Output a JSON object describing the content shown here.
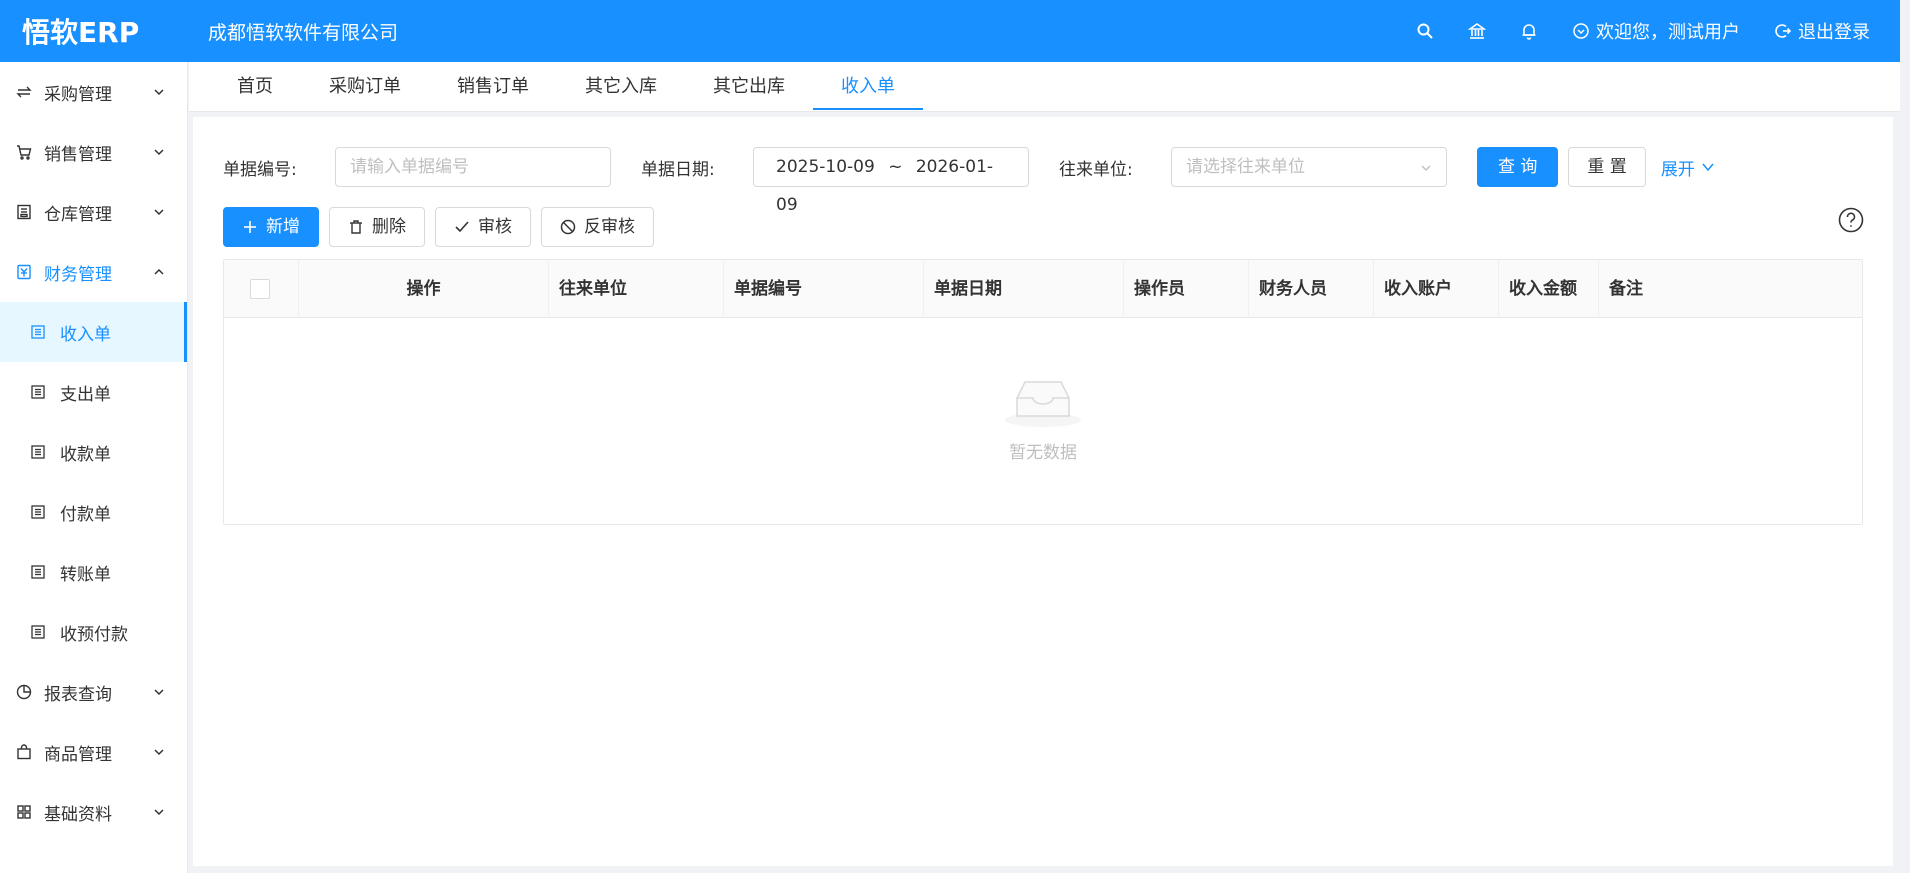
{
  "header": {
    "logo": "悟软ERP",
    "company": "成都悟软软件有限公司",
    "welcome": "欢迎您，测试用户",
    "logout": "退出登录"
  },
  "sidebar": {
    "items": [
      {
        "label": "采购管理",
        "icon": "swap-icon"
      },
      {
        "label": "销售管理",
        "icon": "cart-icon"
      },
      {
        "label": "仓库管理",
        "icon": "warehouse-icon"
      },
      {
        "label": "财务管理",
        "icon": "finance-icon"
      },
      {
        "label": "报表查询",
        "icon": "pie-icon"
      },
      {
        "label": "商品管理",
        "icon": "bag-icon"
      },
      {
        "label": "基础资料",
        "icon": "grid-icon"
      }
    ],
    "finance_sub": [
      {
        "label": "收入单"
      },
      {
        "label": "支出单"
      },
      {
        "label": "收款单"
      },
      {
        "label": "付款单"
      },
      {
        "label": "转账单"
      },
      {
        "label": "收预付款"
      }
    ]
  },
  "tabs": [
    "首页",
    "采购订单",
    "销售订单",
    "其它入库",
    "其它出库",
    "收入单"
  ],
  "filters": {
    "bill_no_label": "单据编号:",
    "bill_no_placeholder": "请输入单据编号",
    "date_label": "单据日期:",
    "date_start": "2025-10-09",
    "date_sep": "~",
    "date_end": "2026-01-09",
    "unit_label": "往来单位:",
    "unit_placeholder": "请选择往来单位",
    "query": "查 询",
    "reset": "重 置",
    "expand": "展开"
  },
  "toolbar": {
    "add": "新增",
    "delete": "删除",
    "audit": "审核",
    "unaudit": "反审核"
  },
  "table": {
    "columns": [
      "操作",
      "往来单位",
      "单据编号",
      "单据日期",
      "操作员",
      "财务人员",
      "收入账户",
      "收入金额",
      "备注"
    ],
    "empty": "暂无数据"
  },
  "colors": {
    "primary": "#1890ff"
  }
}
